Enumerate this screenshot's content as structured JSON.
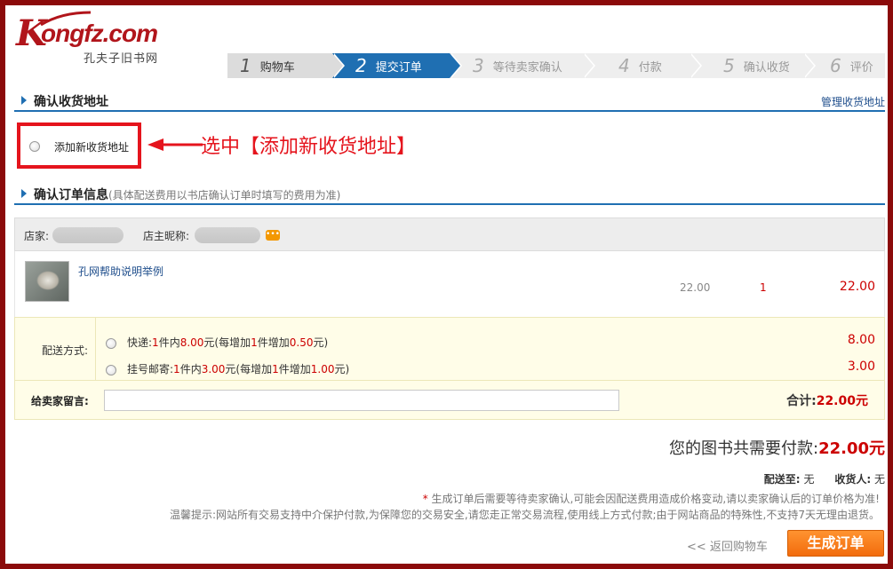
{
  "logo": {
    "brand": "ongfz.com",
    "brand_initial": "K",
    "subtitle": "孔夫子旧书网"
  },
  "steps": [
    {
      "num": "1",
      "label": "购物车",
      "state": "done"
    },
    {
      "num": "2",
      "label": "提交订单",
      "state": "active"
    },
    {
      "num": "3",
      "label": "等待卖家确认",
      "state": "pending"
    },
    {
      "num": "4",
      "label": "付款",
      "state": "pending"
    },
    {
      "num": "5",
      "label": "确认收货",
      "state": "pending"
    },
    {
      "num": "6",
      "label": "评价",
      "state": "pending"
    }
  ],
  "address": {
    "title": "确认收货地址",
    "manage_link": "管理收货地址",
    "add_new_label": "添加新收货地址"
  },
  "annotation": {
    "text": "选中【添加新收货地址】",
    "color": "#e5141d"
  },
  "order": {
    "title": "确认订单信息",
    "note": "(具体配送费用以书店确认订单时填写的费用为准)",
    "shop_label": "店家:",
    "owner_label": "店主昵称:",
    "item": {
      "name": "孔网帮助说明举例",
      "price": "22.00",
      "qty": "1",
      "total": "22.00"
    },
    "shipping": {
      "label": "配送方式:",
      "express": {
        "prefix": "快递:",
        "first_n": "1",
        "first_unit": "件内",
        "first_fee": "8.00",
        "mid": "元(每增加",
        "add_n": "1",
        "add_unit": "件增加",
        "add_fee": "0.50",
        "suffix": "元)",
        "fee": "8.00"
      },
      "registered": {
        "prefix": "挂号邮寄:",
        "first_n": "1",
        "first_unit": "件内",
        "first_fee": "3.00",
        "mid": "元(每增加",
        "add_n": "1",
        "add_unit": "件增加",
        "add_fee": "1.00",
        "suffix": "元)",
        "fee": "3.00"
      }
    },
    "message_label": "给卖家留言:",
    "subtotal_label": "合计:",
    "subtotal_value": "22.00元"
  },
  "payment": {
    "label": "您的图书共需要付款:",
    "amount": "22.00元"
  },
  "ship_to": {
    "dest_label": "配送至:",
    "dest_value": "无",
    "receiver_label": "收货人:",
    "receiver_value": "无"
  },
  "notices": {
    "star": "*",
    "line1": "生成订单后需要等待卖家确认,可能会因配送费用造成价格变动,请以卖家确认后的订单价格为准!",
    "line2": "温馨提示:网站所有交易支持中介保护付款,为保障您的交易安全,请您走正常交易流程,使用线上方式付款;由于网站商品的特殊性,不支持7天无理由退货。"
  },
  "actions": {
    "back": "<< 返回购物车",
    "submit": "生成订单"
  },
  "colors": {
    "brand": "#b1151b",
    "accent_blue": "#1f6fb2",
    "price_red": "#cc0000",
    "submit_orange": "#f26c0d",
    "frame": "#8b0a0a"
  }
}
